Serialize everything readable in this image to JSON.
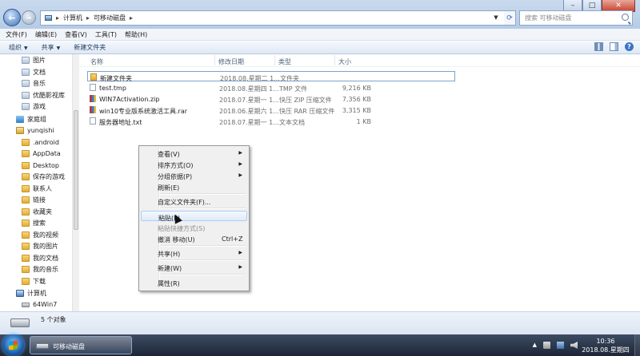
{
  "address": {
    "crumbs": [
      "计算机",
      "可移动磁盘"
    ],
    "search_placeholder": "搜索 可移动磁盘"
  },
  "menu": [
    "文件(F)",
    "编辑(E)",
    "查看(V)",
    "工具(T)",
    "帮助(H)"
  ],
  "toolbar": {
    "organize": "组织",
    "share": "共享",
    "new_folder": "新建文件夹"
  },
  "nav": [
    {
      "label": "图片",
      "icon": "lib"
    },
    {
      "label": "文档",
      "icon": "lib"
    },
    {
      "label": "音乐",
      "icon": "lib"
    },
    {
      "label": "优酷影视库",
      "icon": "lib"
    },
    {
      "label": "游戏",
      "icon": "lib"
    },
    {
      "label": "家庭组",
      "icon": "home"
    },
    {
      "label": "yunqishi",
      "icon": "user"
    },
    {
      "label": ".android",
      "icon": "folder"
    },
    {
      "label": "AppData",
      "icon": "folder"
    },
    {
      "label": "Desktop",
      "icon": "folder"
    },
    {
      "label": "保存的游戏",
      "icon": "folder"
    },
    {
      "label": "联系人",
      "icon": "folder"
    },
    {
      "label": "链接",
      "icon": "folder"
    },
    {
      "label": "收藏夹",
      "icon": "folder"
    },
    {
      "label": "搜索",
      "icon": "folder"
    },
    {
      "label": "我的视频",
      "icon": "folder"
    },
    {
      "label": "我的图片",
      "icon": "folder"
    },
    {
      "label": "我的文档",
      "icon": "folder"
    },
    {
      "label": "我的音乐",
      "icon": "folder"
    },
    {
      "label": "下载",
      "icon": "folder"
    },
    {
      "label": "计算机",
      "icon": "pc"
    },
    {
      "label": "64Win7",
      "icon": "drive"
    }
  ],
  "columns": {
    "name": "名称",
    "date": "修改日期",
    "type": "类型",
    "size": "大小"
  },
  "files": [
    {
      "name": "新建文件夹",
      "date": "2018.08.星期二 1...",
      "type": "文件夹",
      "size": "",
      "icon": "folder"
    },
    {
      "name": "test.tmp",
      "date": "2018.08.星期四 1...",
      "type": "TMP 文件",
      "size": "9,216 KB",
      "icon": "file"
    },
    {
      "name": "WIN7Activation.zip",
      "date": "2018.07.星期一 1...",
      "type": "快压 ZIP 压缩文件",
      "size": "7,356 KB",
      "icon": "zip"
    },
    {
      "name": "win10专业版系统激活工具.rar",
      "date": "2018.06.星期六 1...",
      "type": "快压 RAR 压缩文件",
      "size": "3,315 KB",
      "icon": "zip"
    },
    {
      "name": "服务器地址.txt",
      "date": "2018.07.星期一 1...",
      "type": "文本文档",
      "size": "1 KB",
      "icon": "txt"
    }
  ],
  "context_menu": {
    "view": "查看(V)",
    "sort": "排序方式(O)",
    "group": "分组依据(P)",
    "refresh": "刷新(E)",
    "customize": "自定义文件夹(F)...",
    "paste": "粘贴(P)",
    "paste_shortcut": "粘贴快捷方式(S)",
    "undo": "撤消 移动(U)",
    "undo_shortcut": "Ctrl+Z",
    "share": "共享(H)",
    "new": "新建(W)",
    "properties": "属性(R)"
  },
  "status": {
    "count": "5 个对象"
  },
  "taskbar": {
    "window_label": "可移动磁盘",
    "time": "10:36",
    "date": "2018.08.星期四"
  }
}
